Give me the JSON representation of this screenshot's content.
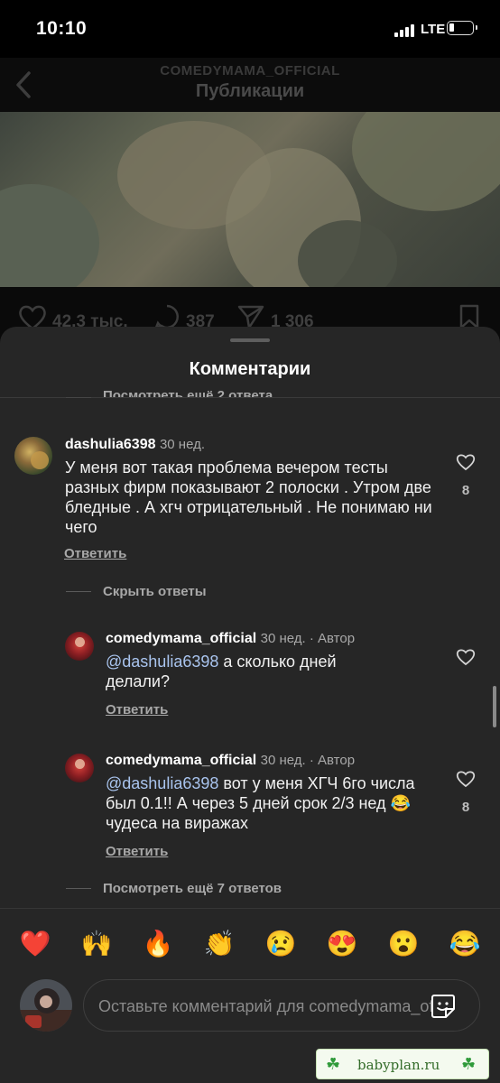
{
  "status_bar": {
    "time": "10:10",
    "network": "LTE"
  },
  "header": {
    "username": "COMEDYMAMA_OFFICIAL",
    "title": "Публикации"
  },
  "post_actions": {
    "likes": "42,3 тыс.",
    "comments": "387",
    "shares": "1 306"
  },
  "sheet": {
    "title": "Комментарии",
    "view_more_top": "Посмотреть ещё 2 ответа",
    "hide_replies": "Скрыть ответы",
    "view_more_bottom": "Посмотреть ещё 7 ответов"
  },
  "comments": [
    {
      "username": "dashulia6398",
      "meta": "30 нед.",
      "text": "У меня вот такая проблема вечером тесты разных фирм показывают 2 полоски . Утром две бледные . А хгч отрицательный . Не понимаю ни чего",
      "reply_label": "Ответить",
      "likes": "8"
    }
  ],
  "replies": [
    {
      "username": "comedymama_official",
      "meta": "30 нед. · Автор",
      "mention": "@dashulia6398",
      "text": " а сколько дней делали?",
      "reply_label": "Ответить",
      "likes": ""
    },
    {
      "username": "comedymama_official",
      "meta": "30 нед. · Автор",
      "mention": "@dashulia6398",
      "text": " вот у меня ХГЧ 6го числа был 0.1!! А через 5 дней срок 2/3 нед 😂 чудеса на виражах",
      "reply_label": "Ответить",
      "likes": "8"
    }
  ],
  "emoji_bar": [
    "❤️",
    "🙌",
    "🔥",
    "👏",
    "😢",
    "😍",
    "😮",
    "😂"
  ],
  "comment_input": {
    "placeholder": "Оставьте комментарий для comedymama_official..."
  },
  "watermark": {
    "text": "babyplan.ru",
    "icon": "clover-icon"
  },
  "colors": {
    "sheet_bg": "#262626",
    "mention": "#a9c4ee",
    "muted": "#a8a8a8"
  }
}
